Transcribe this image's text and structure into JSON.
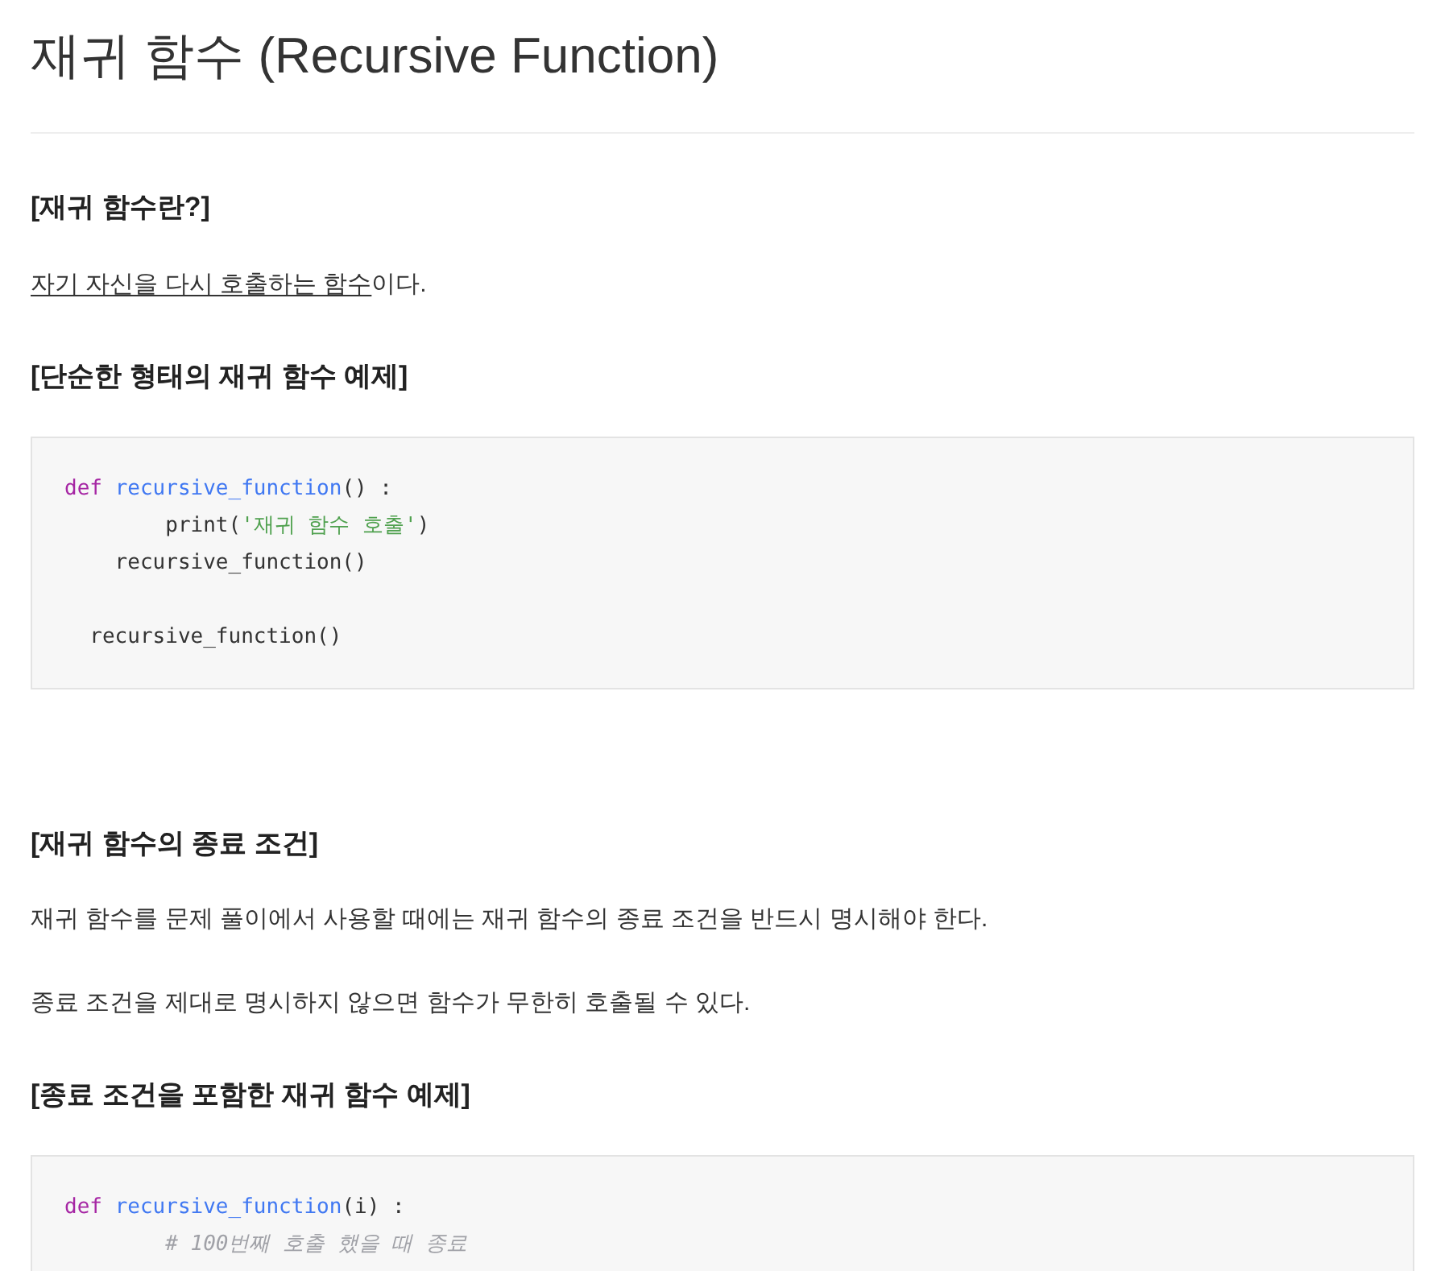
{
  "title": "재귀 함수 (Recursive Function)",
  "blocks": [
    {
      "kind": "heading",
      "text": "[재귀 함수란?]"
    },
    {
      "kind": "paragraph",
      "parts": [
        {
          "text": "자기 자신을 다시 호출하는 함수",
          "underline": true
        },
        {
          "text": "이다.",
          "underline": false
        }
      ]
    },
    {
      "kind": "heading",
      "text": "[단순한 형태의 재귀 함수 예제]"
    },
    {
      "kind": "code",
      "lines": [
        {
          "kind": "code",
          "tokens": [
            {
              "kind": "keyword",
              "text": "def "
            },
            {
              "kind": "function",
              "text": "recursive_function"
            },
            {
              "kind": "plain",
              "text": "() :"
            }
          ]
        },
        {
          "kind": "code",
          "tokens": [
            {
              "kind": "plain",
              "text": "        print("
            },
            {
              "kind": "string",
              "text": "'재귀 함수 호출'"
            },
            {
              "kind": "plain",
              "text": ")"
            }
          ]
        },
        {
          "kind": "code",
          "tokens": [
            {
              "kind": "plain",
              "text": "    recursive_function()"
            }
          ]
        },
        {
          "kind": "blank"
        },
        {
          "kind": "code",
          "tokens": [
            {
              "kind": "plain",
              "text": "  recursive_function()"
            }
          ]
        }
      ]
    },
    {
      "kind": "spacer"
    },
    {
      "kind": "heading",
      "text": "[재귀 함수의 종료 조건]"
    },
    {
      "kind": "paragraph",
      "parts": [
        {
          "text": "재귀 함수를 문제 풀이에서 사용할 때에는 재귀 함수의 종료 조건을 반드시 명시해야 한다.",
          "underline": false
        }
      ]
    },
    {
      "kind": "paragraph",
      "parts": [
        {
          "text": "종료 조건을 제대로 명시하지 않으면 함수가 무한히 호출될 수 있다.",
          "underline": false
        }
      ]
    },
    {
      "kind": "heading",
      "text": "[종료 조건을 포함한 재귀 함수 예제]"
    },
    {
      "kind": "code",
      "lines": [
        {
          "kind": "code",
          "tokens": [
            {
              "kind": "keyword",
              "text": "def "
            },
            {
              "kind": "function",
              "text": "recursive_function"
            },
            {
              "kind": "plain",
              "text": "(i) :"
            }
          ]
        },
        {
          "kind": "code",
          "tokens": [
            {
              "kind": "comment",
              "text": "        # 100번째 호출 했을 때 종료"
            }
          ]
        }
      ]
    }
  ]
}
